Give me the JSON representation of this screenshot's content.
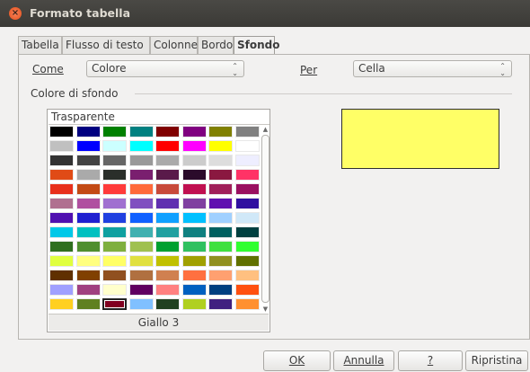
{
  "window": {
    "title": "Formato tabella",
    "close_glyph": "×"
  },
  "tabs": [
    {
      "label": "Tabella",
      "active": false
    },
    {
      "label": "Flusso di testo",
      "active": false
    },
    {
      "label": "Colonne",
      "active": false
    },
    {
      "label": "Bordo",
      "active": false
    },
    {
      "label": "Sfondo",
      "active": true
    }
  ],
  "form": {
    "come_label": "Come",
    "come_value": "Colore",
    "per_label": "Per",
    "per_value": "Cella",
    "section_title": "Colore di sfondo"
  },
  "palette": {
    "transparent_label": "Trasparente",
    "selected_name": "Giallo 3",
    "selected_index": [
      12,
      2
    ],
    "rows": [
      [
        "#000000",
        "#000080",
        "#008000",
        "#008080",
        "#800000",
        "#800080",
        "#808000",
        "#808080"
      ],
      [
        "#c0c0c0",
        "#0000ff",
        "#ccffff",
        "#00ffff",
        "#ff0000",
        "#ff00ff",
        "#ffff00",
        "#ffffff"
      ],
      [
        "#333333",
        "#444444",
        "#666666",
        "#999999",
        "#aaaaaa",
        "#cccccc",
        "#dddddd",
        "#eeeeff"
      ],
      [
        "#e04b16",
        "#aaaaaa",
        "#2a2f2a",
        "#7a1f6f",
        "#5a1a4a",
        "#2b0b2b",
        "#8a1840",
        "#ff3366"
      ],
      [
        "#e8301c",
        "#c34a15",
        "#ff3b3b",
        "#ff6a3a",
        "#c84a3a",
        "#c01050",
        "#a0205a",
        "#9a1060"
      ],
      [
        "#b07090",
        "#b050a0",
        "#a070d0",
        "#8050c0",
        "#6030b0",
        "#8040a0",
        "#6010b0",
        "#3010a0"
      ],
      [
        "#5010b0",
        "#2020d0",
        "#2040e0",
        "#1060ff",
        "#10a0ff",
        "#00c0ff",
        "#a0d0ff",
        "#d0e8f8"
      ],
      [
        "#00c8e8",
        "#00c0c0",
        "#10a0a0",
        "#40b0b0",
        "#20a0a0",
        "#108080",
        "#006060",
        "#004040"
      ],
      [
        "#2f6f1f",
        "#4f8f2f",
        "#7faf3f",
        "#9fc050",
        "#00a030",
        "#30c060",
        "#40e040",
        "#30ff30"
      ],
      [
        "#e0ff40",
        "#ffff80",
        "#ffff66",
        "#e0e040",
        "#c0c000",
        "#a0a000",
        "#909020",
        "#607000"
      ],
      [
        "#603000",
        "#804000",
        "#905020",
        "#b07040",
        "#d08050",
        "#ff7040",
        "#ffa070",
        "#ffc080"
      ],
      [
        "#a0a0ff",
        "#a04080",
        "#ffffcc",
        "#600060",
        "#ff8080",
        "#0060c0",
        "#004080",
        "#ff5010"
      ],
      [
        "#ffd020",
        "#608020",
        "#800020",
        "#80c0ff",
        "#204020",
        "#b0d020",
        "#402080",
        "#ff9030"
      ]
    ]
  },
  "preview_color": "#ffff66",
  "buttons": {
    "ok": "OK",
    "annulla": "Annulla",
    "help": "?",
    "ripristina": "Ripristina"
  },
  "icons": {
    "combo_arrows": "⌃⌄",
    "scroll_up": "▲",
    "scroll_down": "▼"
  }
}
